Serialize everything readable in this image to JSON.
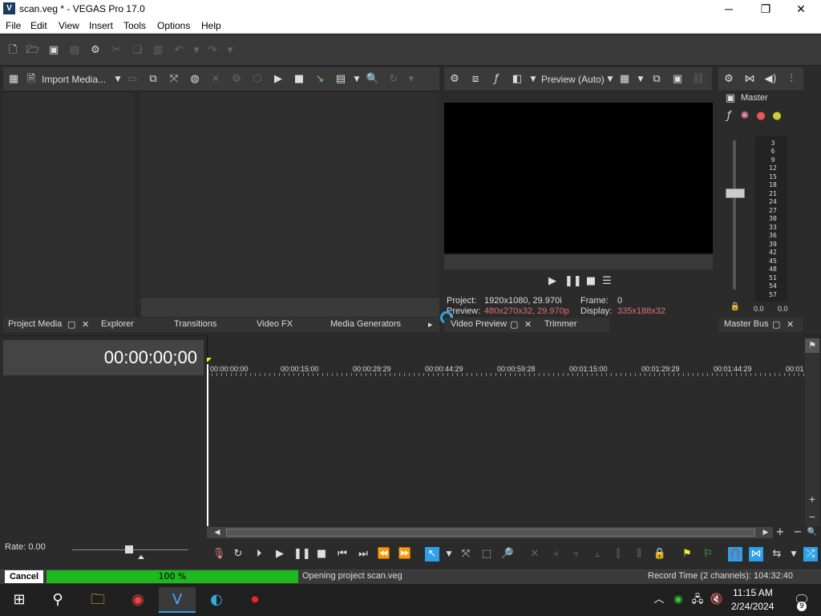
{
  "window": {
    "title": "scan.veg * - VEGAS Pro 17.0",
    "app_icon": "V"
  },
  "menu": [
    "File",
    "Edit",
    "View",
    "Insert",
    "Tools",
    "Options",
    "Help"
  ],
  "media_toolbar": {
    "import_label": "Import Media..."
  },
  "preview_toolbar": {
    "preview_mode": "Preview (Auto)"
  },
  "master": {
    "label": "Master",
    "left_value": "0.0",
    "right_value": "0.0"
  },
  "meter_scale": [
    "3",
    "6",
    "9",
    "12",
    "15",
    "18",
    "21",
    "24",
    "27",
    "30",
    "33",
    "36",
    "39",
    "42",
    "45",
    "48",
    "51",
    "54",
    "57"
  ],
  "preview_info": {
    "project_label": "Project:",
    "project_value": "1920x1080, 29.970i",
    "preview_label": "Preview:",
    "preview_value": "480x270x32, 29.970p",
    "frame_label": "Frame:",
    "frame_value": "0",
    "display_label": "Display:",
    "display_value": "335x188x32"
  },
  "tabs": {
    "project_media": "Project Media",
    "explorer": "Explorer",
    "transitions": "Transitions",
    "video_fx": "Video FX",
    "media_generators": "Media Generators",
    "video_preview": "Video Preview",
    "trimmer": "Trimmer",
    "master_bus": "Master Bus"
  },
  "timeline": {
    "timecode": "00:00:00;00",
    "ruler": [
      "00:00:00:00",
      "00:00:15:00",
      "00:00:29:29",
      "00:00:44:29",
      "00:00:59:28",
      "00:01:15:00",
      "00:01:29:29",
      "00:01:44:29",
      "00:01"
    ],
    "rate": "Rate: 0.00"
  },
  "status": {
    "cancel": "Cancel",
    "progress_text": "100 %",
    "progress": 1.0,
    "message": "Opening project scan.veg",
    "record_time": "Record Time (2 channels): 104:32:40"
  },
  "taskbar": {
    "time": "11:15 AM",
    "date": "2/24/2024",
    "notifications": "9"
  },
  "colors": {
    "accent": "#2ea0e6",
    "progress": "#1fb81f",
    "preview_value": "#e07070"
  }
}
